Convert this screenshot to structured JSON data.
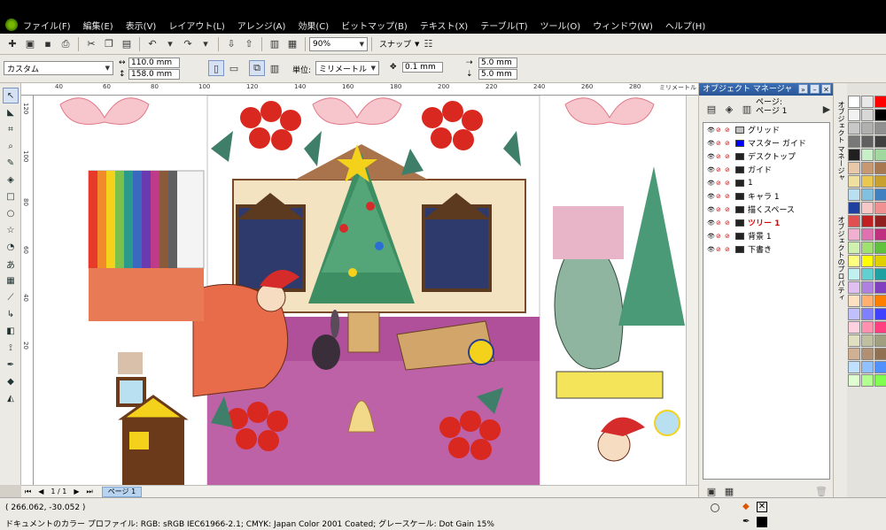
{
  "menu": [
    "ファイル(F)",
    "編集(E)",
    "表示(V)",
    "レイアウト(L)",
    "アレンジ(A)",
    "効果(C)",
    "ビットマップ(B)",
    "テキスト(X)",
    "テーブル(T)",
    "ツール(O)",
    "ウィンドウ(W)",
    "ヘルプ(H)"
  ],
  "toolbar": {
    "zoom": "90%",
    "snap_label": "スナップ"
  },
  "propbar": {
    "paper": "カスタム",
    "width": "110.0 mm",
    "height": "158.0 mm",
    "unit_label": "単位:",
    "unit": "ミリメートル",
    "nudge": "0.1 mm",
    "dup_x": "5.0 mm",
    "dup_y": "5.0 mm"
  },
  "ruler": {
    "top": [
      "40",
      "60",
      "80",
      "100",
      "120",
      "140",
      "160",
      "180",
      "200",
      "220",
      "240",
      "260",
      "280"
    ],
    "unit": "ミリメートル",
    "left": [
      "120",
      "100",
      "80",
      "60",
      "40",
      "20"
    ]
  },
  "page_nav": {
    "counter": "1 / 1",
    "tab": "ページ 1"
  },
  "docker": {
    "title": "オブジェクト マネージャ",
    "page_line1": "ページ:",
    "page_line2": "ページ 1",
    "layers": [
      {
        "name": "グリッド",
        "color": "#c0c0c0",
        "active": false
      },
      {
        "name": "マスター ガイド",
        "color": "#0000ff",
        "active": false
      },
      {
        "name": "デスクトップ",
        "color": "#222222",
        "active": false
      },
      {
        "name": "ガイド",
        "color": "#222222",
        "active": false
      },
      {
        "name": "1",
        "color": "#222222",
        "active": false
      },
      {
        "name": "キャラ 1",
        "color": "#222222",
        "active": false
      },
      {
        "name": "描くスペース",
        "color": "#222222",
        "active": false
      },
      {
        "name": "ツリー 1",
        "color": "#222222",
        "active": true
      },
      {
        "name": "背景 1",
        "color": "#222222",
        "active": false
      },
      {
        "name": "下書き",
        "color": "#222222",
        "active": false
      }
    ],
    "active_color": "#e00000"
  },
  "side_tabs": [
    "オブジェクト マネージャ",
    "オブジェクトのプロパティ"
  ],
  "palette": [
    "#ffffff",
    "#e8e8e8",
    "#ff0000",
    "#f2f2f2",
    "#d8d8d8",
    "#000000",
    "#c8c8c8",
    "#b0b0b0",
    "#909090",
    "#787878",
    "#606060",
    "#404040",
    "#202020",
    "#c8f0c8",
    "#a0d8a0",
    "#e8c8a8",
    "#c89870",
    "#a87850",
    "#f0e0a0",
    "#e8c850",
    "#c8a030",
    "#b8e0f0",
    "#80c0e0",
    "#4080c0",
    "#2040a0",
    "#f8c8c8",
    "#f09090",
    "#e05050",
    "#c02020",
    "#902020",
    "#f0b0d0",
    "#e070b0",
    "#c03080",
    "#d0f0b0",
    "#a0e070",
    "#60c040",
    "#ffff80",
    "#ffff00",
    "#e0d000",
    "#c0f0f0",
    "#60d0d0",
    "#20a0a0",
    "#e0c0f0",
    "#b080e0",
    "#8040c0",
    "#ffe0c0",
    "#ffb070",
    "#ff8000",
    "#c0c0ff",
    "#8080ff",
    "#4040ff",
    "#ffd0e0",
    "#ff90b0",
    "#ff4080",
    "#e0e0c0",
    "#c0c0a0",
    "#a0a080",
    "#d0b090",
    "#b09070",
    "#907050",
    "#c0e0ff",
    "#90c0ff",
    "#5090ff",
    "#e0ffd0",
    "#b0ff90",
    "#80ff50"
  ],
  "status": {
    "coords": "( 266.062, -30.052 )",
    "profile": "ドキュメントのカラー プロファイル: RGB: sRGB IEC61966-2.1; CMYK: Japan Color 2001 Coated; グレースケール: Dot Gain 15%"
  }
}
